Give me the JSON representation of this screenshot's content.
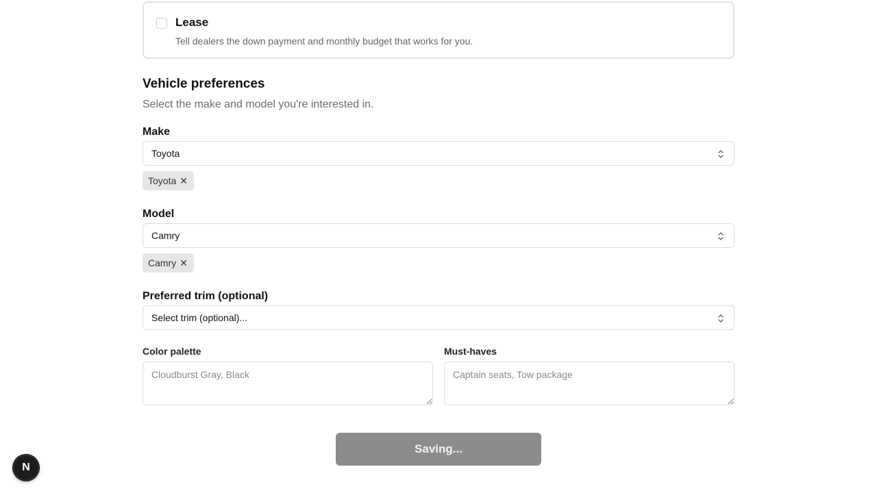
{
  "lease": {
    "title": "Lease",
    "description": "Tell dealers the down payment and monthly budget that works for you.",
    "checked": false
  },
  "vehicle_preferences": {
    "title": "Vehicle preferences",
    "subtitle": "Select the make and model you're interested in."
  },
  "make": {
    "label": "Make",
    "value": "Toyota",
    "chips": [
      "Toyota"
    ]
  },
  "model": {
    "label": "Model",
    "value": "Camry",
    "chips": [
      "Camry"
    ]
  },
  "trim": {
    "label": "Preferred trim (optional)",
    "value": "Select trim (optional)..."
  },
  "color_palette": {
    "label": "Color palette",
    "placeholder": "Cloudburst Gray, Black",
    "value": ""
  },
  "must_haves": {
    "label": "Must-haves",
    "placeholder": "Captain seats, Tow package",
    "value": ""
  },
  "save_button": {
    "label": "Saving..."
  },
  "icons": {
    "chip_remove": "close-icon",
    "select_chevron": "chevron-up-down-icon",
    "dev_badge": "N"
  },
  "colors": {
    "save_button_bg": "#8c8c8c",
    "chip_bg": "#e6e6e6",
    "badge_bg": "#1c1c1c"
  }
}
